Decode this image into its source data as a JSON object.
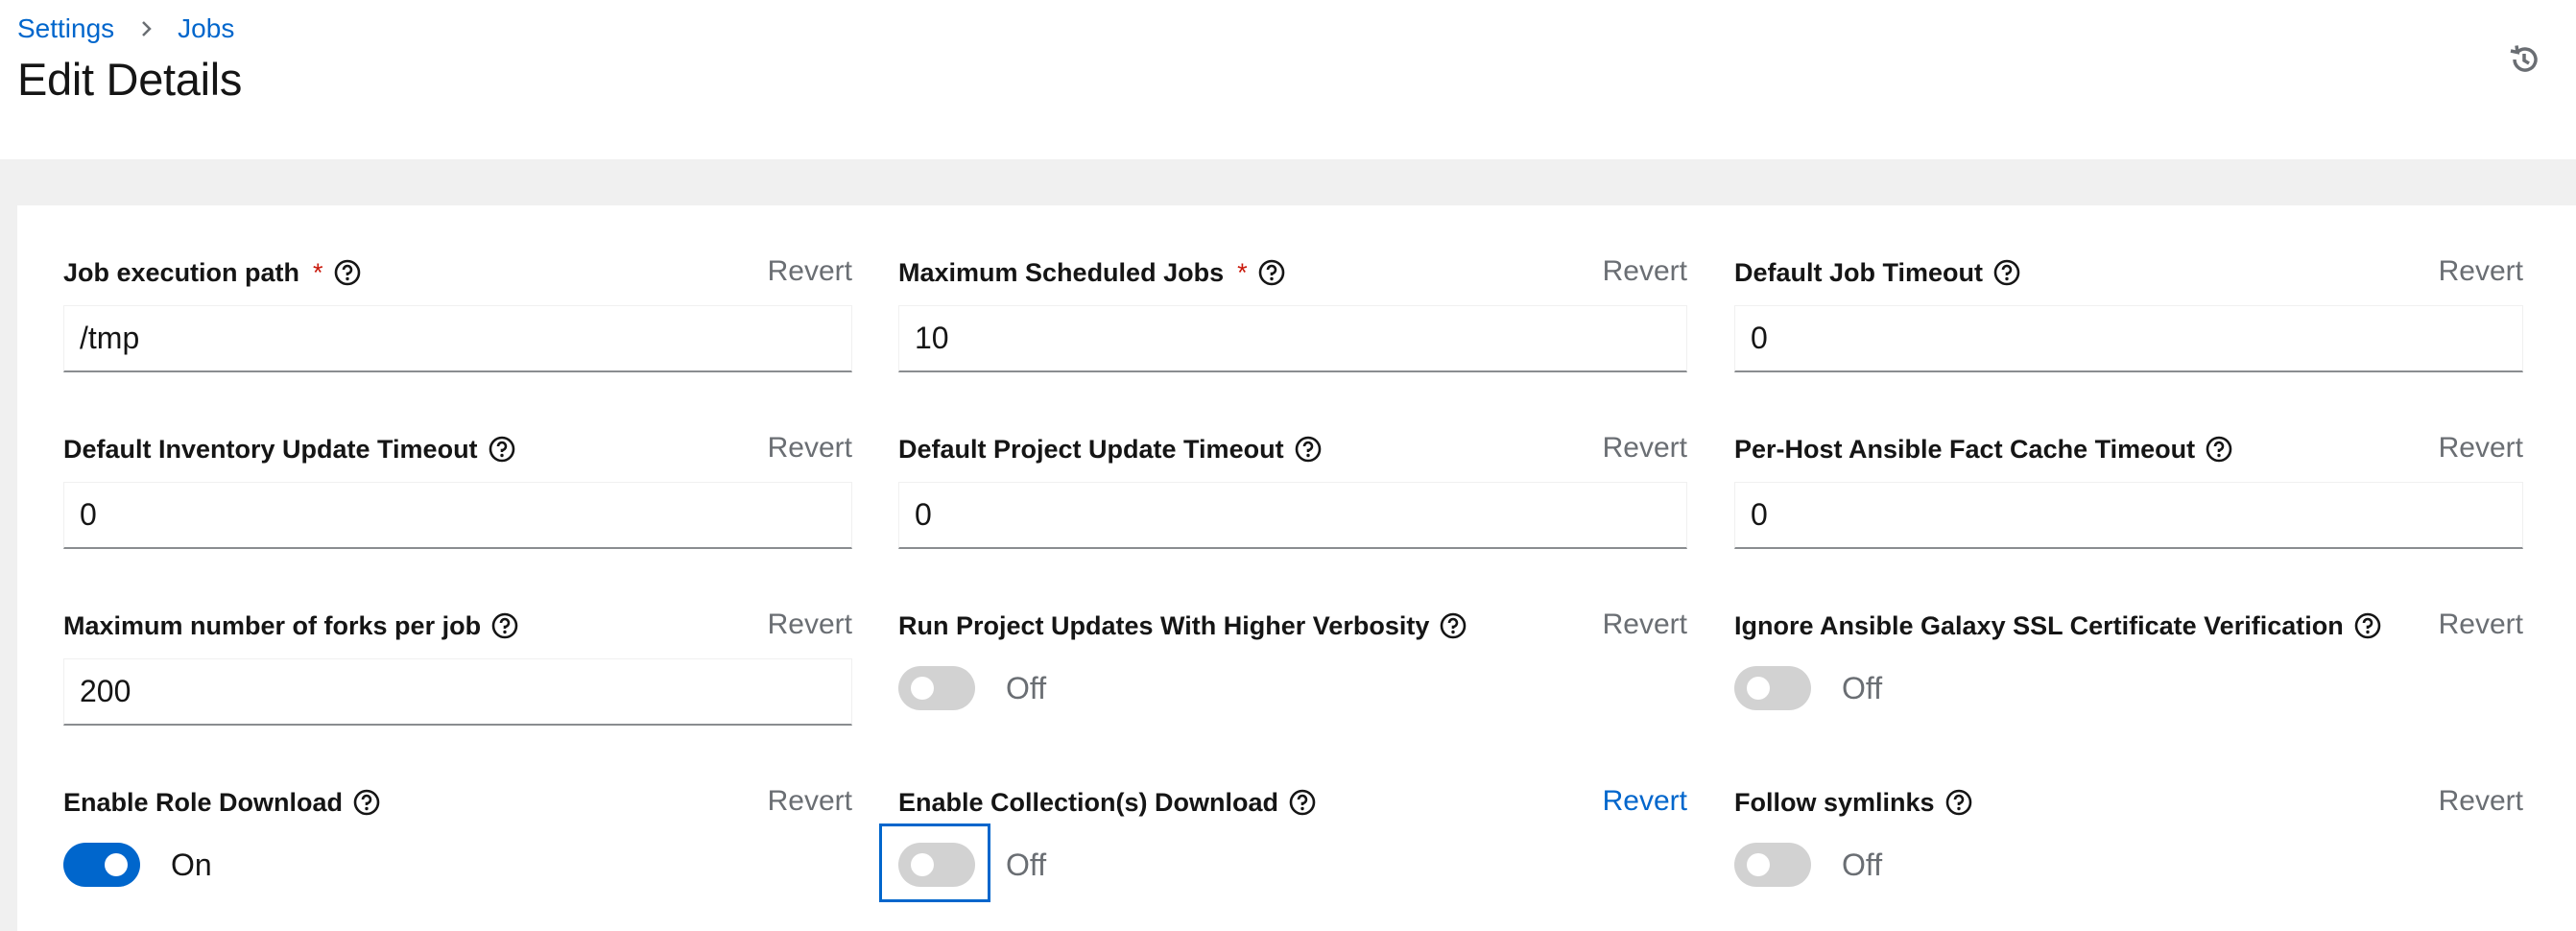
{
  "breadcrumb": {
    "items": [
      "Settings",
      "Jobs"
    ]
  },
  "page": {
    "title": "Edit Details"
  },
  "fields": {
    "job_execution_path": {
      "label": "Job execution path",
      "required": "*",
      "value": "/tmp",
      "revert": "Revert"
    },
    "max_scheduled_jobs": {
      "label": "Maximum Scheduled Jobs",
      "required": "*",
      "value": "10",
      "revert": "Revert"
    },
    "default_job_timeout": {
      "label": "Default Job Timeout",
      "value": "0",
      "revert": "Revert"
    },
    "default_inventory_update_timeout": {
      "label": "Default Inventory Update Timeout",
      "value": "0",
      "revert": "Revert"
    },
    "default_project_update_timeout": {
      "label": "Default Project Update Timeout",
      "value": "0",
      "revert": "Revert"
    },
    "per_host_fact_cache_timeout": {
      "label": "Per-Host Ansible Fact Cache Timeout",
      "value": "0",
      "revert": "Revert"
    },
    "max_forks_per_job": {
      "label": "Maximum number of forks per job",
      "value": "200",
      "revert": "Revert"
    },
    "run_project_updates_verbosity": {
      "label": "Run Project Updates With Higher Verbosity",
      "state": "Off",
      "revert": "Revert"
    },
    "ignore_galaxy_ssl": {
      "label": "Ignore Ansible Galaxy SSL Certificate Verification",
      "state": "Off",
      "revert": "Revert"
    },
    "enable_role_download": {
      "label": "Enable Role Download",
      "state": "On",
      "revert": "Revert"
    },
    "enable_collections_download": {
      "label": "Enable Collection(s) Download",
      "state": "Off",
      "revert": "Revert"
    },
    "follow_symlinks": {
      "label": "Follow symlinks",
      "state": "Off",
      "revert": "Revert"
    }
  },
  "colors": {
    "accent": "#0066cc",
    "required": "#c9190b",
    "muted": "#6a6e73"
  },
  "icons": {
    "help": "help-circle-icon",
    "history": "history-icon",
    "separator": "chevron-right-icon"
  }
}
